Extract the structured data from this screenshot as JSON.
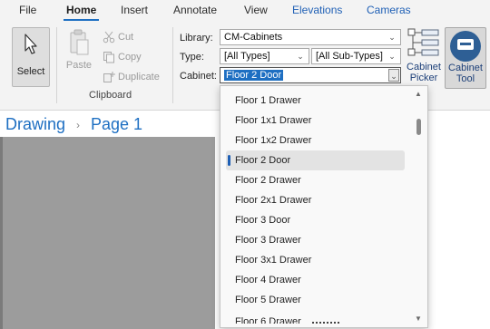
{
  "tabs": [
    {
      "label": "File"
    },
    {
      "label": "Home"
    },
    {
      "label": "Insert"
    },
    {
      "label": "Annotate"
    },
    {
      "label": "View"
    },
    {
      "label": "Elevations"
    },
    {
      "label": "Cameras"
    }
  ],
  "active_tab": "Home",
  "ribbon": {
    "select_label": "Select",
    "paste_label": "Paste",
    "cut_label": "Cut",
    "copy_label": "Copy",
    "duplicate_label": "Duplicate",
    "clipboard_group_label": "Clipboard",
    "library_label": "Library:",
    "library_value": "CM-Cabinets",
    "type_label": "Type:",
    "type_value": "[All Types]",
    "subtype_value": "[All Sub-Types]",
    "cabinet_label": "Cabinet:",
    "cabinet_value": "Floor 2 Door",
    "cabinet_picker_line1": "Cabinet",
    "cabinet_picker_line2": "Picker",
    "cabinet_tool_line1": "Cabinet",
    "cabinet_tool_line2": "Tool"
  },
  "breadcrumb": {
    "root": "Drawing",
    "current": "Page 1"
  },
  "dropdown": {
    "selected": "Floor 2 Door",
    "options": [
      "Floor 1 Drawer",
      "Floor 1x1 Drawer",
      "Floor 1x2 Drawer",
      "Floor 2 Door",
      "Floor 2 Drawer",
      "Floor 2x1 Drawer",
      "Floor 3 Door",
      "Floor 3 Drawer",
      "Floor 3x1 Drawer",
      "Floor 4 Drawer",
      "Floor 5 Drawer",
      "Floor 6 Drawer"
    ]
  },
  "colors": {
    "accent": "#1e6fc2",
    "ribbon_bg": "#f3f3f3",
    "canvas_gray": "#9c9c9c"
  }
}
